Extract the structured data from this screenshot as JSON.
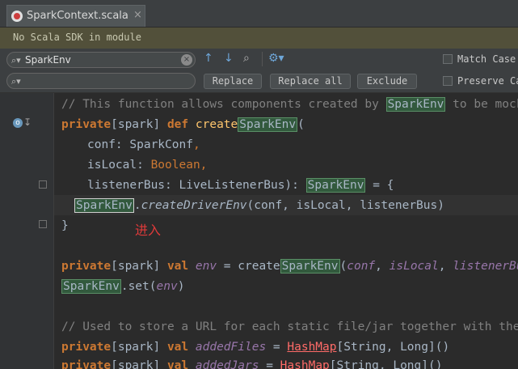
{
  "tab": {
    "title": "SparkContext.scala",
    "close": "×"
  },
  "banner": {
    "text": "No Scala SDK in module"
  },
  "find": {
    "search_value": "SparkEnv",
    "replace_value": "",
    "replace_label": "Replace",
    "replace_all_label": "Replace all",
    "exclude_label": "Exclude",
    "match_case_label": "Match Case",
    "preserve_case_label": "Preserve Ca"
  },
  "annotation": "进入",
  "code": {
    "l1_comment": "// This function allows components created by ",
    "l1_hl": "SparkEnv",
    "l1_rest": " to be mocked in",
    "l2_kw1": "private",
    "l2_mod": "[spark] ",
    "l2_kw2": "def",
    "l2_fn": " create",
    "l2_hl": "SparkEnv",
    "l2_rest": "(",
    "l3_name": "conf: SparkConf",
    "l3_comma": ",",
    "l4_name": "isLocal: ",
    "l4_type": "Boolean,",
    "l5_name": "listenerBus: LiveListenerBus): ",
    "l5_hl": "SparkEnv",
    "l5_rest": " = {",
    "l6_hl": "SparkEnv",
    "l6_dot": ".",
    "l6_fn": "createDriverEnv",
    "l6_rest": "(conf, isLocal, listenerBus)",
    "l7": "}",
    "l9_kw1": "private",
    "l9_mod": "[spark] ",
    "l9_kw2": "val",
    "l9_var": " env",
    "l9_eq": " = create",
    "l9_hl": "SparkEnv",
    "l9_p1": "(",
    "l9_a1": "conf",
    "l9_c1": ", ",
    "l9_a2": "isLocal",
    "l9_c2": ", ",
    "l9_a3": "listenerBus",
    "l9_p2": ")",
    "l10_hl": "SparkEnv",
    "l10_mid": ".set(",
    "l10_arg": "env",
    "l10_end": ")",
    "l12_comment": "// Used to store a URL for each static file/jar together with the file's",
    "l13_kw1": "private",
    "l13_mod": "[spark] ",
    "l13_kw2": "val",
    "l13_var": " addedFiles",
    "l13_eq": " = ",
    "l13_type": "HashMap",
    "l13_rest": "[String, Long]()",
    "l14_kw1": "private",
    "l14_mod": "[spark] ",
    "l14_kw2": "val",
    "l14_var": " addedJars",
    "l14_eq": " = ",
    "l14_type": "HashMap",
    "l14_rest": "[String, Long]()"
  },
  "colors": {
    "keyword": "#cc7832",
    "comment": "#808080",
    "highlight": "#32593d",
    "annotation": "#e03a3a"
  }
}
